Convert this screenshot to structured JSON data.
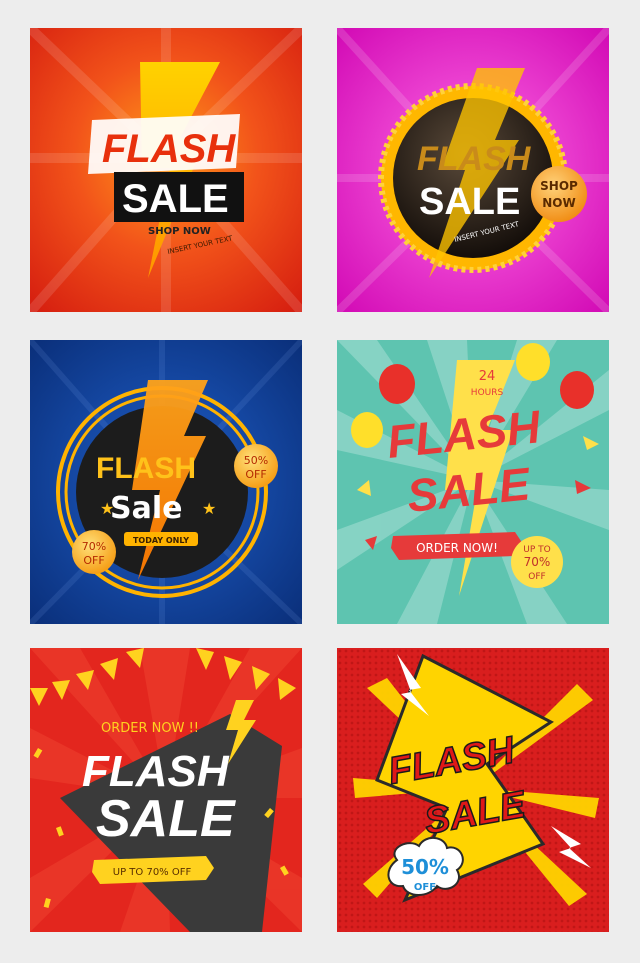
{
  "tiles": [
    {
      "title_line1": "FLASH",
      "title_line2": "SALE",
      "cta": "SHOP NOW",
      "tagline": "INSERT YOUR TEXT",
      "colors": {
        "bg": "#e8300c",
        "bolt": "#ffb300",
        "panel": "#111111"
      }
    },
    {
      "title_line1": "FLASH",
      "title_line2": "SALE",
      "cta_line1": "SHOP",
      "cta_line2": "NOW",
      "tagline": "INSERT YOUR TEXT",
      "colors": {
        "bg": "#e315c7",
        "bolt": "#ffc400",
        "badge": "#1a1410"
      }
    },
    {
      "title_line1": "FLASH",
      "title_line2": "Sale",
      "ribbon": "TODAY ONLY",
      "badge_top_line1": "50%",
      "badge_top_line2": "OFF",
      "badge_bottom_line1": "70%",
      "badge_bottom_line2": "OFF",
      "colors": {
        "bg": "#0b3a8f",
        "ring": "#ffb300",
        "disc": "#1c1c1c"
      }
    },
    {
      "hours_line1": "24",
      "hours_line2": "HOURS",
      "title_line1": "FLASH",
      "title_line2": "SALE",
      "ribbon": "ORDER NOW!",
      "badge_line1": "UP TO",
      "badge_line2": "70%",
      "badge_line3": "OFF",
      "colors": {
        "bg": "#5ec4b0",
        "text": "#e63a3a",
        "bolt": "#ffe04a"
      }
    },
    {
      "order": "ORDER NOW !!",
      "title_line1": "FLASH",
      "title_line2": "SALE",
      "ribbon": "UP TO 70% OFF",
      "colors": {
        "bg": "#e3261e",
        "panel": "#3a3a3a",
        "accent": "#ffd21f"
      }
    },
    {
      "title_line1": "FLASH",
      "title_line2": "SALE",
      "bubble_line1": "50%",
      "bubble_line2": "OFF",
      "colors": {
        "bg": "#d91e1e",
        "bolt": "#ffd400",
        "bubble": "#1e8fd8"
      }
    }
  ]
}
